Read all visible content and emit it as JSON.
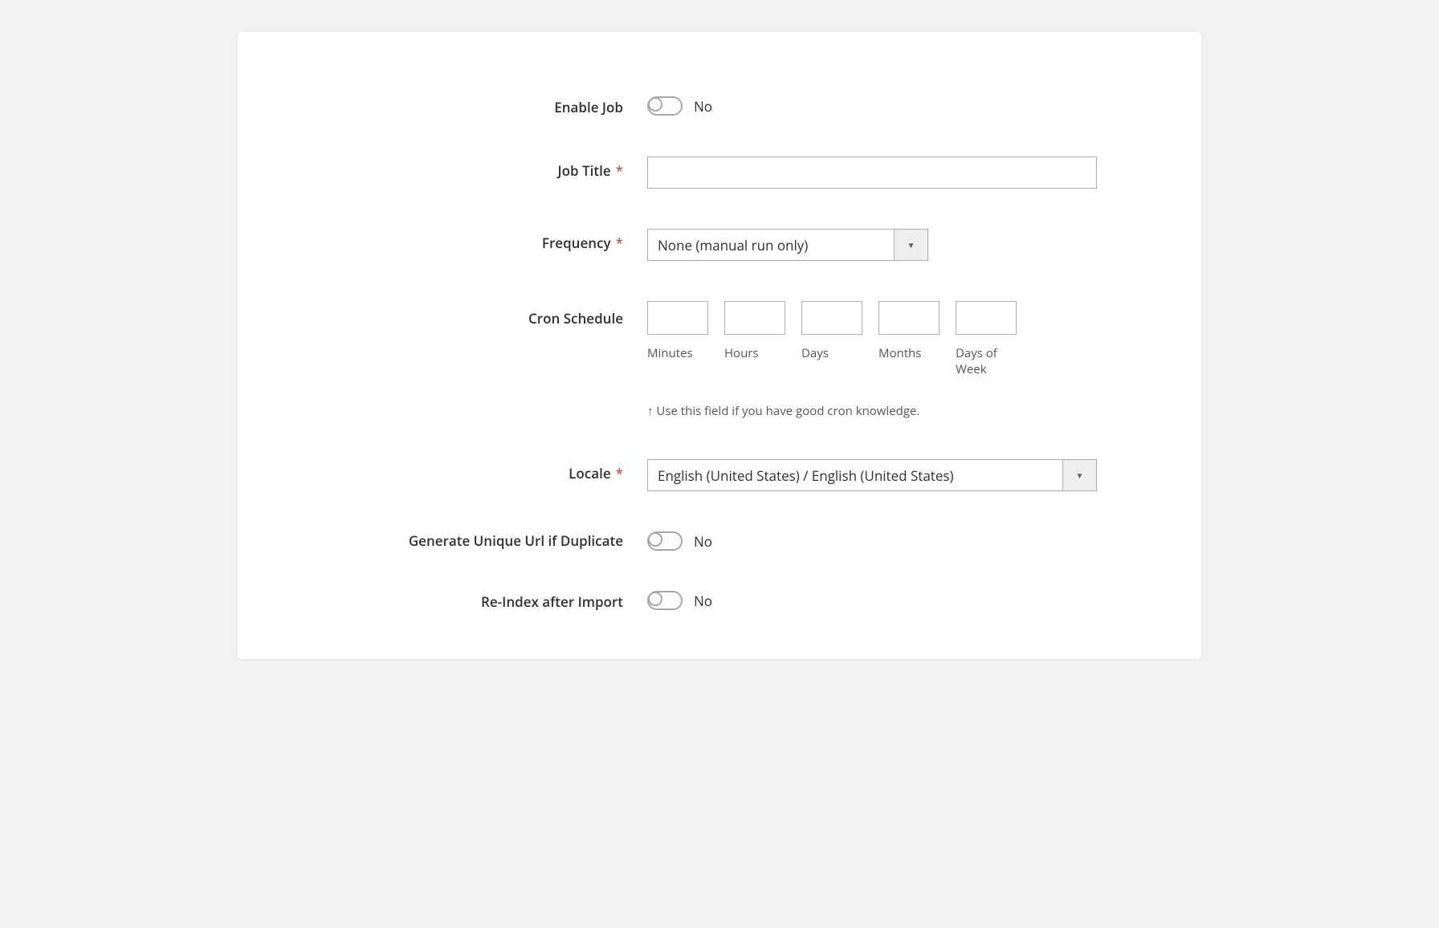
{
  "fields": {
    "enable_job": {
      "label": "Enable Job",
      "value_text": "No"
    },
    "job_title": {
      "label": "Job Title",
      "required": "*",
      "value": ""
    },
    "frequency": {
      "label": "Frequency",
      "required": "*",
      "selected": "None (manual run only)"
    },
    "cron": {
      "label": "Cron Schedule",
      "cols": {
        "minutes": {
          "label": "Minutes",
          "value": ""
        },
        "hours": {
          "label": "Hours",
          "value": ""
        },
        "days": {
          "label": "Days",
          "value": ""
        },
        "months": {
          "label": "Months",
          "value": ""
        },
        "dow": {
          "label": "Days of Week",
          "value": ""
        }
      },
      "note": "↑ Use this field if you have good cron knowledge."
    },
    "locale": {
      "label": "Locale",
      "required": "*",
      "selected": "English (United States) / English (United States)"
    },
    "unique_url": {
      "label": "Generate Unique Url if Duplicate",
      "value_text": "No"
    },
    "reindex": {
      "label": "Re-Index after Import",
      "value_text": "No"
    }
  }
}
